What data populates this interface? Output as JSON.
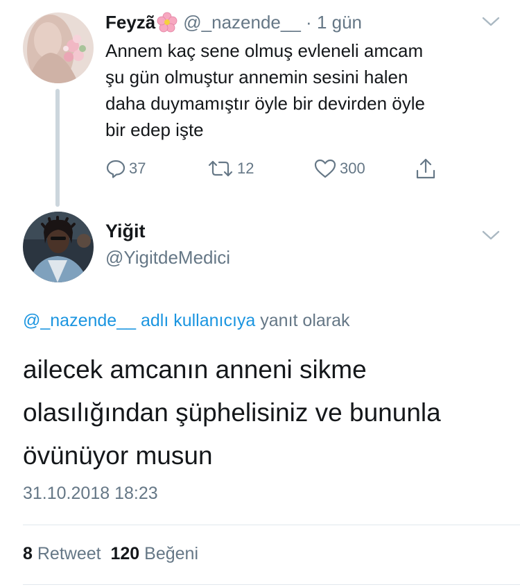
{
  "parent_tweet": {
    "display_name": "Feyzã",
    "name_emoji": "cherry-blossom-icon",
    "handle": "@_nazende__",
    "separator": "·",
    "time_ago": "1 gün",
    "text_lines": [
      "Annem kaç sene olmuş evleneli amcam",
      "şu gün olmuştur annemin sesini halen",
      "daha duymamıştır öyle bir devirden öyle",
      "bir edep işte"
    ],
    "replies": "37",
    "retweets": "12",
    "likes": "300"
  },
  "main_tweet": {
    "display_name": "Yiğit",
    "handle": "@YigitdeMedici",
    "replying_to_link": "@_nazende__ adlı kullanıcıya",
    "replying_to_rest": "yanıt olarak",
    "text_lines": [
      "ailecek amcanın anneni sikme",
      "olasılığından şüphelisiniz ve bununla",
      "övünüyor musun"
    ],
    "timestamp": "31.10.2018 18:23",
    "retweet_count": "8",
    "retweet_label": "Retweet",
    "like_count": "120",
    "like_label": "Beğeni"
  },
  "colors": {
    "link": "#1b95e0",
    "muted": "#657786",
    "text": "#14171a",
    "thread_line": "#ccd6dd"
  }
}
